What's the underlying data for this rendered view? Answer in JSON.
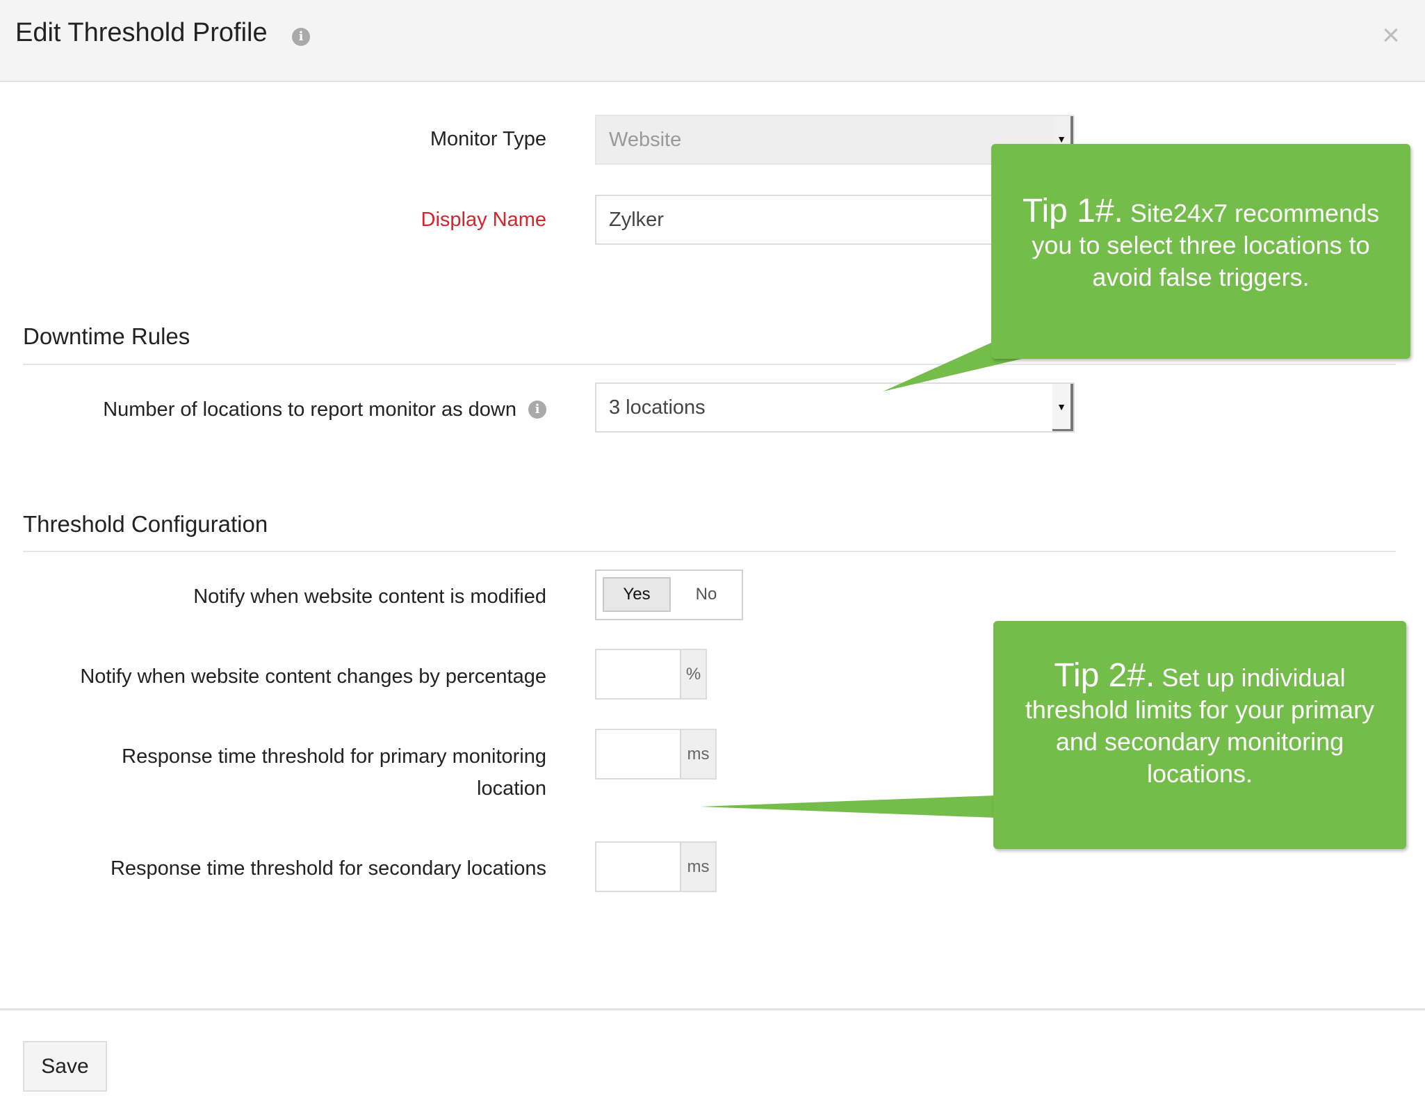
{
  "dialog": {
    "title": "Edit Threshold Profile",
    "title_info_icon": "i",
    "close_icon": "×"
  },
  "form": {
    "monitor_type": {
      "label": "Monitor Type",
      "value": "Website",
      "disabled": true
    },
    "display_name": {
      "label": "Display Name",
      "value": "Zylker",
      "required": true
    }
  },
  "downtime_rules": {
    "heading": "Downtime Rules",
    "locations": {
      "label": "Number of locations to report monitor as down",
      "info_icon": "i",
      "value": "3 locations"
    }
  },
  "threshold_config": {
    "heading": "Threshold Configuration",
    "content_modified": {
      "label": "Notify when website content is modified",
      "options": [
        "Yes",
        "No"
      ],
      "selected": "Yes"
    },
    "content_percentage": {
      "label": "Notify when website content changes by percentage",
      "value": "",
      "unit": "%"
    },
    "primary_response": {
      "label_line1": "Response time threshold for primary monitoring",
      "label_line2": "location",
      "value": "",
      "unit": "ms"
    },
    "secondary_response": {
      "label": "Response time threshold for secondary locations",
      "value": "",
      "unit": "ms"
    }
  },
  "footer": {
    "save_label": "Save"
  },
  "tips": [
    {
      "heading": "Tip 1#.",
      "body_first": "Site24x7 recommends",
      "body_rest": "you to select three locations to avoid false triggers."
    },
    {
      "heading": "Tip 2#.",
      "body_first": "Set up individual",
      "body_rest": "threshold limits for your primary and secondary monitoring locations."
    }
  ],
  "colors": {
    "tip_green": "#74bd4a",
    "required_label": "#d8232a"
  }
}
